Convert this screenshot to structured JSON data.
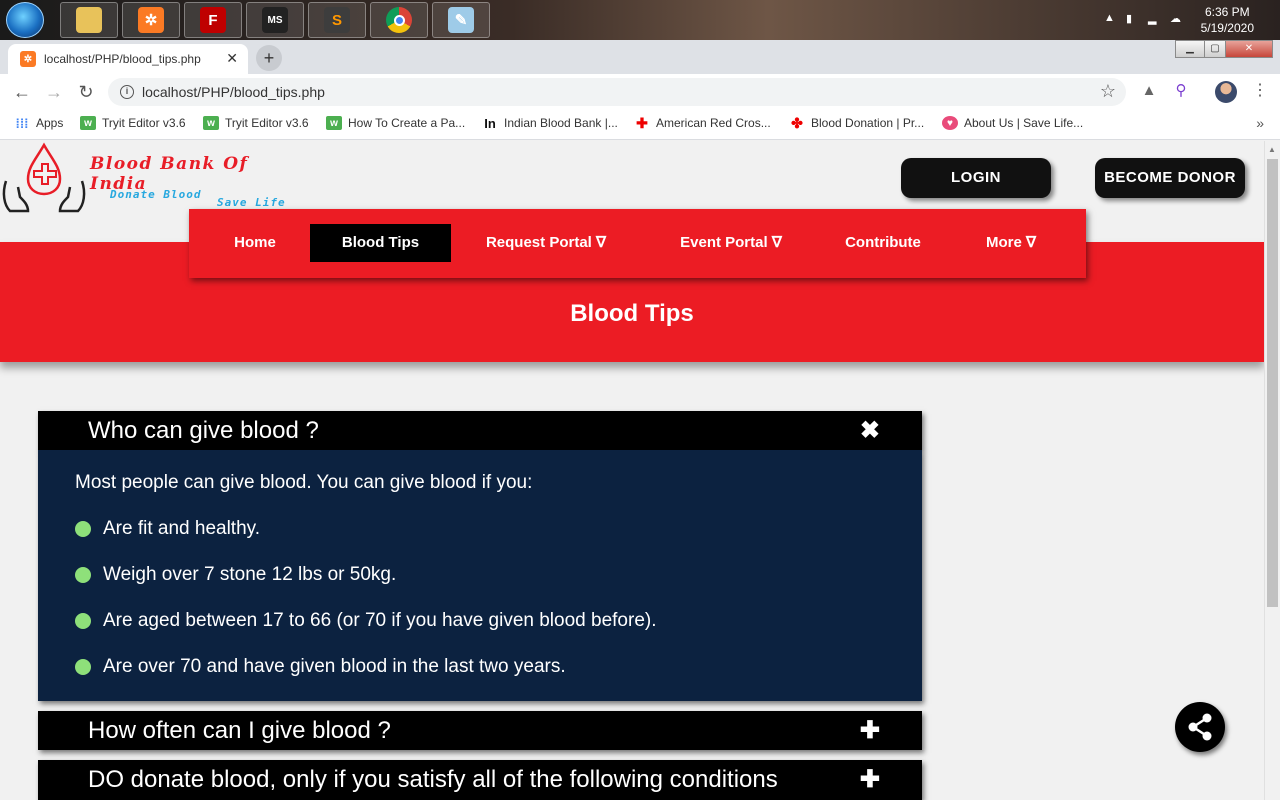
{
  "os": {
    "time": "6:36 PM",
    "date": "5/19/2020",
    "taskbar_apps": [
      "file-explorer",
      "xampp",
      "filezilla",
      "ms-tc",
      "sublime-text",
      "chrome",
      "paint"
    ]
  },
  "browser": {
    "tab_title": "localhost/PHP/blood_tips.php",
    "tab_close": "✕",
    "new_tab": "+",
    "url": "localhost/PHP/blood_tips.php",
    "bookmarks": [
      {
        "label": "Apps",
        "icon": "apps-grid-icon"
      },
      {
        "label": "Tryit Editor v3.6",
        "icon": "w3schools-icon"
      },
      {
        "label": "Tryit Editor v3.6",
        "icon": "w3schools-icon"
      },
      {
        "label": "How To Create a Pa...",
        "icon": "w3schools-icon"
      },
      {
        "label": "Indian Blood Bank |...",
        "icon": "in-icon"
      },
      {
        "label": "American Red Cros...",
        "icon": "red-cross-icon"
      },
      {
        "label": "Blood Donation | Pr...",
        "icon": "blood-drop-icon"
      },
      {
        "label": "About Us | Save Life...",
        "icon": "heart-icon"
      }
    ]
  },
  "site": {
    "logo_title": "Blood Bank Of India",
    "logo_sub1": "Donate Blood",
    "logo_sub2": "Save Life",
    "login": "LOGIN",
    "become_donor": "BECOME DONOR",
    "nav": [
      "Home",
      "Blood Tips",
      "Request Portal ∇",
      "Event Portal ∇",
      "Contribute",
      "More ∇"
    ],
    "active_nav": "Blood Tips",
    "heading": "Blood Tips",
    "accordion": [
      {
        "title": "Who can give blood ?",
        "toggle": "✖",
        "expanded": true,
        "intro": "Most people can give blood. You can give blood if you:",
        "bullets": [
          "Are fit and healthy.",
          "Weigh over 7 stone 12 lbs or 50kg.",
          "Are aged between 17 to 66 (or 70 if you have given blood before).",
          "Are over 70 and have given blood in the last two years."
        ]
      },
      {
        "title": "How often can I give blood ?",
        "toggle": "✚",
        "expanded": false
      },
      {
        "title": "DO donate blood, only if you satisfy all of the following conditions",
        "toggle": "✚",
        "expanded": false
      }
    ]
  },
  "colors": {
    "brand_red": "#ec1c24",
    "accordion_body": "#0c2240",
    "bullet_green": "#8ee07a"
  }
}
